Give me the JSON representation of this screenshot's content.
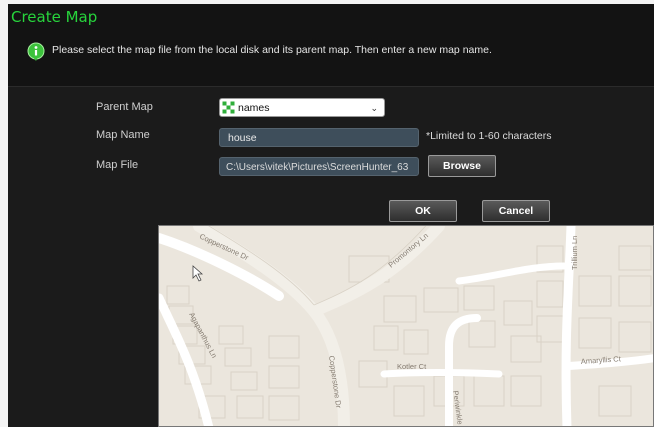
{
  "dialog": {
    "title": "Create Map",
    "instruction": "Please select the map file from the local disk and its parent map. Then enter a new map name."
  },
  "form": {
    "parent_map_label": "Parent Map",
    "parent_map_value": "names",
    "map_name_label": "Map Name",
    "map_name_value": "house",
    "map_name_hint": "*Limited to 1-60 characters",
    "map_file_label": "Map File",
    "map_file_value": "C:\\Users\\vitek\\Pictures\\ScreenHunter_63",
    "browse_label": "Browse"
  },
  "actions": {
    "ok_label": "OK",
    "cancel_label": "Cancel"
  },
  "map_preview": {
    "streets": [
      "Copperstone Dr",
      "Promontory Ln",
      "Agapanthus Ln",
      "Kotler Ct",
      "Periwinkle Ln",
      "Amaryllis Ct",
      "Trillium Ln"
    ]
  },
  "colors": {
    "title_green": "#27d43c",
    "dialog_bg": "#1b1b1b",
    "input_bg": "#3e4e5b",
    "map_bg": "#ebe6dd"
  }
}
